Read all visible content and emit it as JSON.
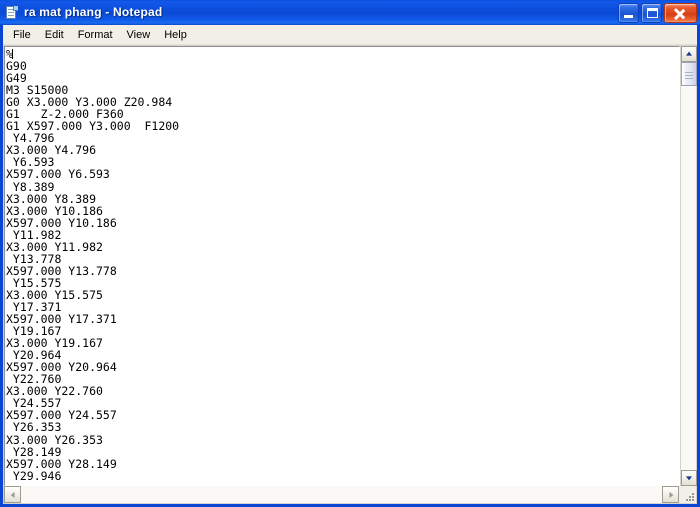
{
  "window": {
    "title": "ra mat phang - Notepad",
    "icon": "notepad-document-icon",
    "accent_color": "#0a45d6",
    "titlebar_gradient_from": "#0a52e0",
    "titlebar_gradient_to": "#0d44c6",
    "close_button_color": "#d83f16"
  },
  "window_buttons": {
    "minimize": {
      "name": "minimize-button",
      "glyph": "minimize-icon"
    },
    "maximize": {
      "name": "maximize-button",
      "glyph": "maximize-icon"
    },
    "close": {
      "name": "close-button",
      "glyph": "close-icon"
    }
  },
  "menubar": {
    "items": [
      {
        "label": "File"
      },
      {
        "label": "Edit"
      },
      {
        "label": "Format"
      },
      {
        "label": "View"
      },
      {
        "label": "Help"
      }
    ]
  },
  "document": {
    "caret_line": 1,
    "lines": [
      "%",
      "G90",
      "G49",
      "M3 S15000",
      "G0 X3.000 Y3.000 Z20.984",
      "G1   Z-2.000 F360",
      "G1 X597.000 Y3.000  F1200",
      " Y4.796",
      "X3.000 Y4.796",
      " Y6.593",
      "X597.000 Y6.593",
      " Y8.389",
      "X3.000 Y8.389",
      "X3.000 Y10.186",
      "X597.000 Y10.186",
      " Y11.982",
      "X3.000 Y11.982",
      " Y13.778",
      "X597.000 Y13.778",
      " Y15.575",
      "X3.000 Y15.575",
      " Y17.371",
      "X597.000 Y17.371",
      " Y19.167",
      "X3.000 Y19.167",
      " Y20.964",
      "X597.000 Y20.964",
      " Y22.760",
      "X3.000 Y22.760",
      " Y24.557",
      "X597.000 Y24.557",
      " Y26.353",
      "X3.000 Y26.353",
      " Y28.149",
      "X597.000 Y28.149",
      " Y29.946"
    ]
  },
  "scrollbars": {
    "vertical": {
      "up_arrow": "scroll-up-arrow",
      "down_arrow": "scroll-down-arrow",
      "thumb_position_percent": 0,
      "thumb_size_percent": 6
    },
    "horizontal": {
      "left_arrow": "scroll-left-arrow",
      "right_arrow": "scroll-right-arrow"
    },
    "resize_grip": "resize-grip"
  }
}
